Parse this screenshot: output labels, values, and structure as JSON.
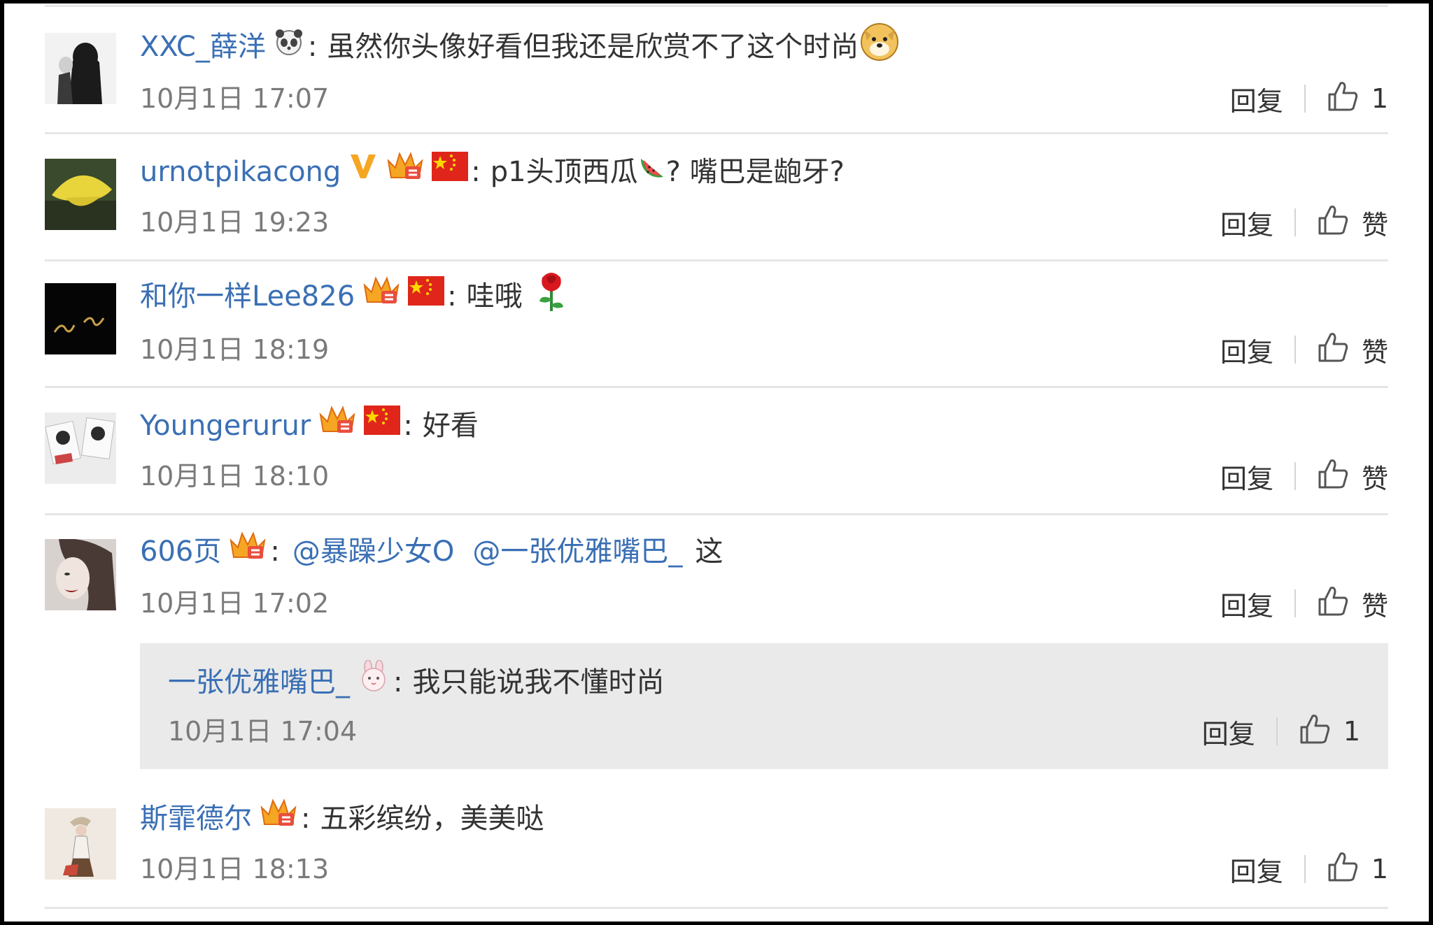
{
  "comments": [
    {
      "username": "XXC_薛洋",
      "text": "虽然你头像好看但我还是欣赏不了这个时尚",
      "time": "10月1日 17:07",
      "reply_label": "回复",
      "like_label": "1",
      "avatar_colors": [
        "#f2f2f2",
        "#1b1b1b"
      ]
    },
    {
      "username": "urnotpikacong",
      "text_part1": "p1头顶西瓜",
      "text_part2": "? 嘴巴是龅牙?",
      "time": "10月1日 19:23",
      "reply_label": "回复",
      "like_label": "赞",
      "avatar_colors": [
        "#e8d53c",
        "#3a4a2c"
      ]
    },
    {
      "username": "和你一样Lee826",
      "text": "哇哦",
      "time": "10月1日 18:19",
      "reply_label": "回复",
      "like_label": "赞",
      "avatar_colors": [
        "#050505",
        "#c9a04a"
      ]
    },
    {
      "username": "Youngerurur",
      "text": "好看",
      "time": "10月1日 18:10",
      "reply_label": "回复",
      "like_label": "赞",
      "avatar_colors": [
        "#ececec",
        "#2b2b2b"
      ]
    },
    {
      "username": "606页",
      "mention1": "@暴躁少女O",
      "mention2": "@一张优雅嘴巴_",
      "text": "这",
      "time": "10月1日 17:02",
      "reply_label": "回复",
      "like_label": "赞",
      "avatar_colors": [
        "#d8d2cf",
        "#8a1a1a"
      ],
      "reply": {
        "username": "一张优雅嘴巴_",
        "text": "我只能说我不懂时尚",
        "time": "10月1日 17:04",
        "reply_label": "回复",
        "like_label": "1"
      }
    },
    {
      "username": "斯霏德尔",
      "text": "五彩缤纷，美美哒",
      "time": "10月1日 18:13",
      "reply_label": "回复",
      "like_label": "1",
      "avatar_colors": [
        "#efe9e2",
        "#6a4a33"
      ]
    }
  ],
  "colors": {
    "username": "#3a6fb4",
    "text": "#333333",
    "meta": "#7a7a7a",
    "divider": "#e6e6e6",
    "reply_bg": "#eaeaea"
  }
}
